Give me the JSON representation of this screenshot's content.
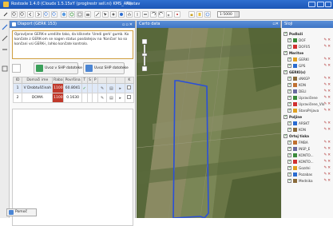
{
  "title": {
    "text": "Rostoxle 1.4.0 (Cloudx 1.5.15xY (proglrestr sell.ni) KMS_ARI)",
    "status": "Nastav"
  },
  "toolbar": {
    "scale_value": "1:5000"
  },
  "left_panel": {
    "header": "Diaport (GERK 153)",
    "info": "Opravljene GERK-e urediite tako, da kliknete 'Uredi gerk' gumb. Ko končate z GERK-om se nagen status posdatejov na 'Končan' ko so končani vsi GERK-i, lahko končate kontrolo.",
    "btn_uvoz1": "Uvoz v SHP datoteke",
    "btn_uvoz2": "Uvoz SHP datoteke",
    "table": {
      "headers": [
        "ID",
        "Domači ime",
        "Raba",
        "Površina",
        "T",
        "S",
        "P",
        "",
        "",
        "",
        "K"
      ],
      "rows": [
        {
          "id": "1",
          "name": "V Drobtuščinah",
          "raba": "1100",
          "area": "60.8041",
          "t": "✓"
        },
        {
          "id": "2",
          "name": "DOMA",
          "raba": "1100",
          "area": "0.1630",
          "t": ""
        }
      ]
    },
    "help_button": "Pomoč"
  },
  "map_panel": {
    "header": "Carto data"
  },
  "layers_panel": {
    "header": "Sloji",
    "groups": [
      {
        "label": "Podloži",
        "items": [
          "DOF",
          "DOF05"
        ]
      },
      {
        "label": "Meritve",
        "items": [
          "GERKI",
          "GPS"
        ]
      },
      {
        "label": "GERKI(s)",
        "items": [
          "sNKGP",
          "KON",
          "DELI",
          "Upravičene",
          "Upravičene_Vlo",
          "StaroPrijava"
        ]
      },
      {
        "label": "Poljine",
        "items": [
          "ARSKT",
          "KON"
        ]
      },
      {
        "label": "Ortoj tiska",
        "items": [
          "FMBA",
          "INSP_E",
          "KONTO...",
          "KONTO...",
          "Gozdni",
          "Pozabas",
          "Mednika"
        ]
      }
    ]
  },
  "colors": {
    "title_bar": "#1c56b6",
    "panel_header": "#3e74c4",
    "selected_parcel": "#2a4fd8",
    "raba_badge": "#c0392b"
  }
}
